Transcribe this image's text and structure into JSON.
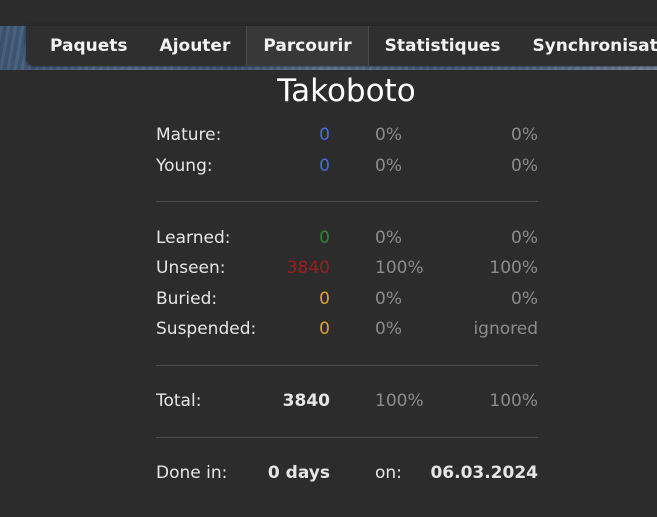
{
  "nav": {
    "tabs": [
      {
        "label": "Paquets"
      },
      {
        "label": "Ajouter"
      },
      {
        "label": "Parcourir"
      },
      {
        "label": "Statistiques"
      },
      {
        "label": "Synchronisation"
      }
    ],
    "active_tab": "Parcourir"
  },
  "deck_title": "Takoboto",
  "stats": {
    "mature": {
      "label": "Mature:",
      "count": "0",
      "pct": "0%",
      "pct2": "0%"
    },
    "young": {
      "label": "Young:",
      "count": "0",
      "pct": "0%",
      "pct2": "0%"
    },
    "learned": {
      "label": "Learned:",
      "count": "0",
      "pct": "0%",
      "pct2": "0%"
    },
    "unseen": {
      "label": "Unseen:",
      "count": "3840",
      "pct": "100%",
      "pct2": "100%"
    },
    "buried": {
      "label": "Buried:",
      "count": "0",
      "pct": "0%",
      "pct2": "0%"
    },
    "suspended": {
      "label": "Suspended:",
      "count": "0",
      "pct": "0%",
      "pct2": "ignored"
    },
    "total": {
      "label": "Total:",
      "count": "3840",
      "pct": "100%",
      "pct2": "100%"
    },
    "done": {
      "label": "Done in:",
      "days": "0 days",
      "on_label": "on:",
      "date": "06.03.2024"
    }
  },
  "colors": {
    "mature": "#3b6fe0",
    "young": "#3b6fe0",
    "learned": "#2a8a2a",
    "unseen": "#a11b1b",
    "buried": "#e0a030",
    "suspended": "#e0a030"
  }
}
